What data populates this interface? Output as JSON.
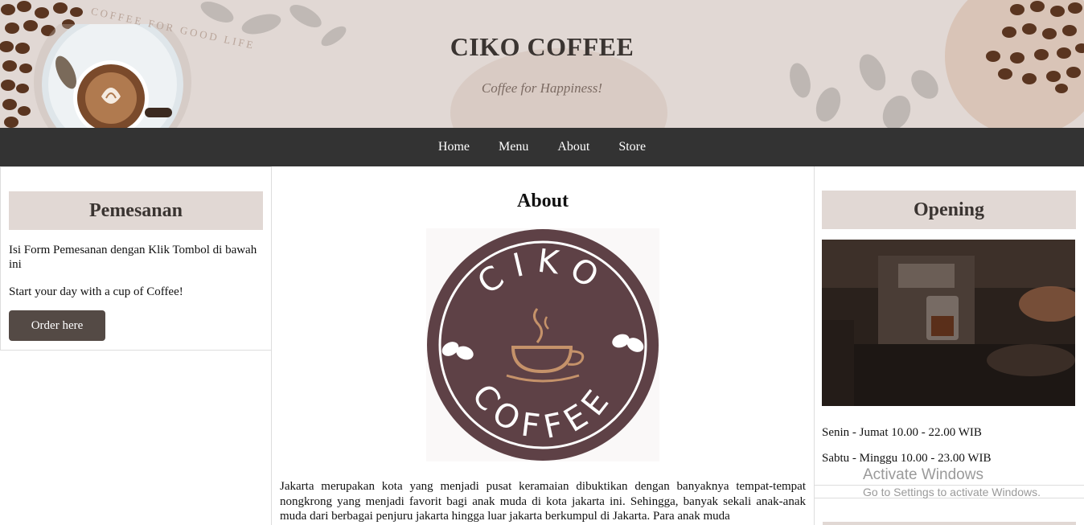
{
  "header": {
    "title": "CIKO COFFEE",
    "tagline": "Coffee for Happiness!",
    "cup_caption": "COFFEE FOR GOOD LIFE"
  },
  "nav": {
    "items": [
      "Home",
      "Menu",
      "About",
      "Store"
    ]
  },
  "left": {
    "heading": "Pemesanan",
    "text1": "Isi Form Pemesanan dengan Klik Tombol di bawah ini",
    "text2": "Start your day with a cup of Coffee!",
    "button": "Order here"
  },
  "center": {
    "heading": "About",
    "logo_top": "CIKO",
    "logo_bottom": "COFFEE",
    "paragraph": "Jakarta merupakan kota yang menjadi pusat keramaian dibuktikan dengan banyaknya tempat-tempat nongkrong yang menjadi favorit bagi anak muda di kota jakarta ini. Sehingga, banyak sekali anak-anak muda dari berbagai penjuru jakarta hingga luar jakarta berkumpul di Jakarta. Para anak muda"
  },
  "right": {
    "heading": "Opening",
    "hours1": "Senin - Jumat 10.00 - 22.00 WIB",
    "hours2": "Sabtu - Minggu 10.00 - 23.00 WIB"
  },
  "watermark": {
    "line1": "Activate Windows",
    "line2": "Go to Settings to activate Windows."
  },
  "colors": {
    "header_bg": "#e1d8d4",
    "nav_bg": "#333333",
    "button_bg": "#544a45",
    "logo": "#5e4146"
  }
}
